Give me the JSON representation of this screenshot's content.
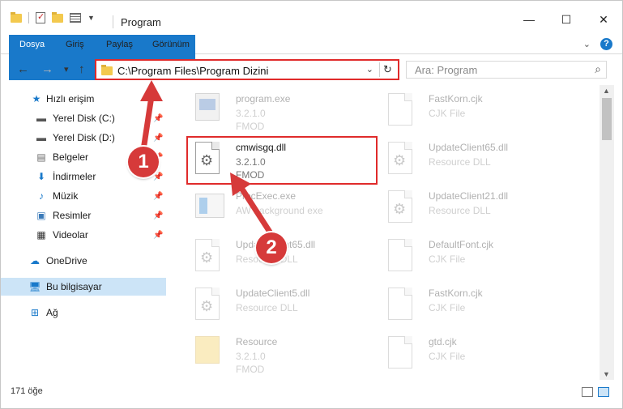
{
  "window": {
    "title": "Program",
    "controls": {
      "minimize": "—",
      "maximize": "☐",
      "close": "✕"
    }
  },
  "ribbon": {
    "tabs": [
      "Dosya",
      "Giriş",
      "Paylaş",
      "Görünüm"
    ],
    "expand_icon": "chevron-down-icon",
    "help_label": "?"
  },
  "nav": {
    "back": "←",
    "forward": "→",
    "recent": "▾",
    "up": "↑"
  },
  "address": {
    "path": "C:\\Program Files\\Program Dizini",
    "refresh": "↻"
  },
  "search": {
    "placeholder": "Ara: Program"
  },
  "sidebar": {
    "items": [
      {
        "label": "Hızlı erişim",
        "icon": "star-icon"
      },
      {
        "label": "Yerel Disk (C:)",
        "icon": "drive-icon",
        "pinned": true
      },
      {
        "label": "Yerel Disk (D:)",
        "icon": "drive-icon",
        "pinned": true
      },
      {
        "label": "Belgeler",
        "icon": "documents-icon",
        "pinned": true
      },
      {
        "label": "İndirmeler",
        "icon": "download-icon",
        "pinned": true
      },
      {
        "label": "Müzik",
        "icon": "music-icon",
        "pinned": true
      },
      {
        "label": "Resimler",
        "icon": "pictures-icon",
        "pinned": true
      },
      {
        "label": "Videolar",
        "icon": "video-icon",
        "pinned": true
      },
      {
        "label": "OneDrive",
        "icon": "cloud-icon"
      },
      {
        "label": "Bu bilgisayar",
        "icon": "computer-icon",
        "selected": true
      },
      {
        "label": "Ağ",
        "icon": "network-icon"
      }
    ]
  },
  "files": [
    {
      "name": "program.exe",
      "line2": "3.2.1.0",
      "line3": "FMOD",
      "icon": "exe-icon",
      "faded": true
    },
    {
      "name": "FastKorn.cjk",
      "line2": "CJK File",
      "line3": "",
      "icon": "document-icon",
      "faded": true
    },
    {
      "name": "cmwisgq.dll",
      "line2": "3.2.1.0",
      "line3": "FMOD",
      "icon": "dll-gear-icon",
      "faded": false
    },
    {
      "name": "UpdateClient65.dll",
      "line2": "Resource DLL",
      "line3": "",
      "icon": "dll-gear-icon",
      "faded": true
    },
    {
      "name": "ProcExec.exe",
      "line2": "AW background exe",
      "line3": "",
      "icon": "window-exe-icon",
      "faded": true
    },
    {
      "name": "UpdateClient21.dll",
      "line2": "Resource DLL",
      "line3": "",
      "icon": "dll-gear-icon",
      "faded": true
    },
    {
      "name": "UpdateClient65.dll",
      "line2": "Resource DLL",
      "line3": "",
      "icon": "dll-gear-icon",
      "faded": true
    },
    {
      "name": "DefaultFont.cjk",
      "line2": "CJK File",
      "line3": "",
      "icon": "document-icon",
      "faded": true
    },
    {
      "name": "UpdateClient5.dll",
      "line2": "Resource DLL",
      "line3": "",
      "icon": "dll-gear-icon",
      "faded": true
    },
    {
      "name": "FastKorn.cjk",
      "line2": "CJK File",
      "line3": "",
      "icon": "document-icon",
      "faded": true
    },
    {
      "name": "Resource",
      "line2": "3.2.1.0",
      "line3": "FMOD",
      "icon": "folder-icon",
      "faded": true
    },
    {
      "name": "gtd.cjk",
      "line2": "CJK File",
      "line3": "",
      "icon": "document-icon",
      "faded": true
    }
  ],
  "callouts": [
    "1",
    "2"
  ],
  "status": {
    "count": "171 öğe"
  },
  "colors": {
    "accent": "#1979ca",
    "highlight": "#e02b2b",
    "callout": "#d63a3a"
  }
}
